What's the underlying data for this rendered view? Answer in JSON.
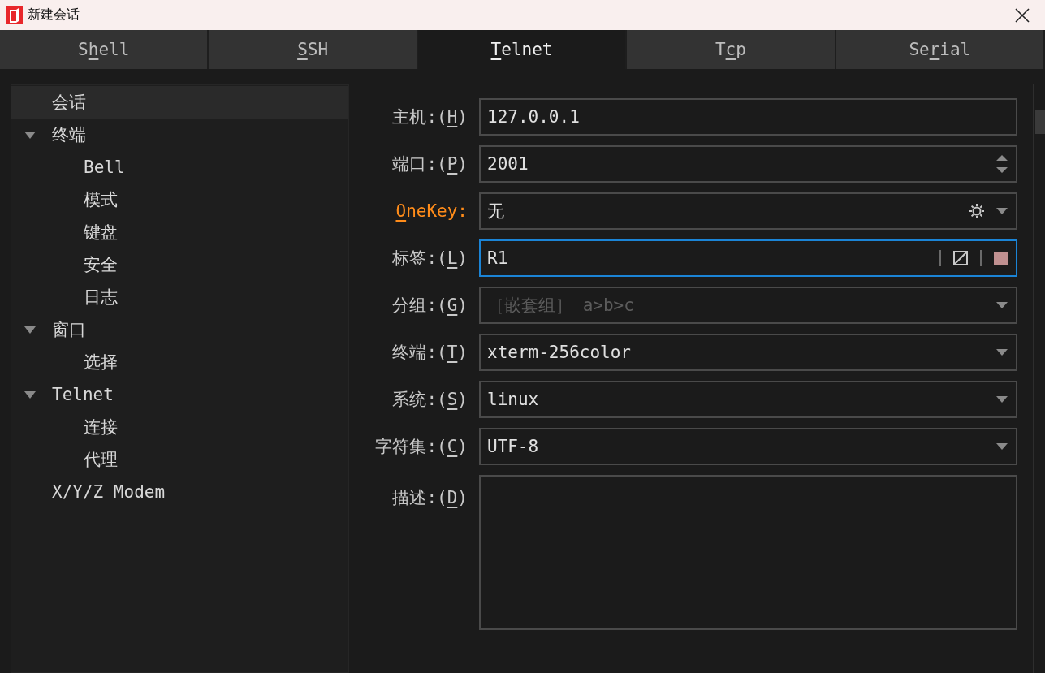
{
  "window": {
    "title": "新建会话"
  },
  "tabs": [
    {
      "pre": "S",
      "key": "h",
      "post": "ell",
      "selected": false
    },
    {
      "key": "S",
      "post": "SH",
      "selected": false
    },
    {
      "key": "T",
      "post": "elnet",
      "selected": true
    },
    {
      "pre": "T",
      "key": "c",
      "post": "p",
      "selected": false
    },
    {
      "pre": "Se",
      "key": "r",
      "post": "ial",
      "selected": false
    }
  ],
  "sidebar": {
    "items": [
      {
        "label": "会话",
        "selected": true
      },
      {
        "label": "终端",
        "selected": false,
        "expanded": true,
        "children": [
          {
            "label": "Bell",
            "selected": false
          },
          {
            "label": "模式",
            "selected": false
          },
          {
            "label": "键盘",
            "selected": false
          },
          {
            "label": "安全",
            "selected": false
          },
          {
            "label": "日志",
            "selected": false
          }
        ]
      },
      {
        "label": "窗口",
        "selected": false,
        "expanded": true,
        "children": [
          {
            "label": "选择",
            "selected": false
          }
        ]
      },
      {
        "label": "Telnet",
        "selected": false,
        "expanded": true,
        "children": [
          {
            "label": "连接",
            "selected": false
          },
          {
            "label": "代理",
            "selected": false
          }
        ]
      },
      {
        "label": "X/Y/Z Modem",
        "selected": false
      }
    ]
  },
  "form": {
    "fields": [
      {
        "kind": "text",
        "label": {
          "pre": "主机:(",
          "key": "H",
          "post": ")"
        },
        "value": "127.0.0.1"
      },
      {
        "kind": "spin",
        "label": {
          "pre": "端口:(",
          "key": "P",
          "post": ")"
        },
        "value": "2001"
      },
      {
        "kind": "combo-gear",
        "highlight": true,
        "label": {
          "key": "O",
          "post": "neKey:"
        },
        "value": "无"
      },
      {
        "kind": "tag",
        "focused": true,
        "color": "#c09090",
        "label": {
          "pre": "标签:(",
          "key": "L",
          "post": ")"
        },
        "value": "R1"
      },
      {
        "kind": "combo",
        "label": {
          "pre": "分组:(",
          "key": "G",
          "post": ")"
        },
        "placeholder": "［嵌套组］ a>b>c"
      },
      {
        "kind": "combo",
        "label": {
          "pre": "终端:(",
          "key": "T",
          "post": ")"
        },
        "value": "xterm-256color"
      },
      {
        "kind": "combo",
        "label": {
          "pre": "系统:(",
          "key": "S",
          "post": ")"
        },
        "value": "linux"
      },
      {
        "kind": "combo",
        "label": {
          "pre": "字符集:(",
          "key": "C",
          "post": ")"
        },
        "value": "UTF-8"
      },
      {
        "kind": "textarea",
        "label": {
          "pre": "描述:(",
          "key": "D",
          "post": ")"
        }
      }
    ]
  }
}
